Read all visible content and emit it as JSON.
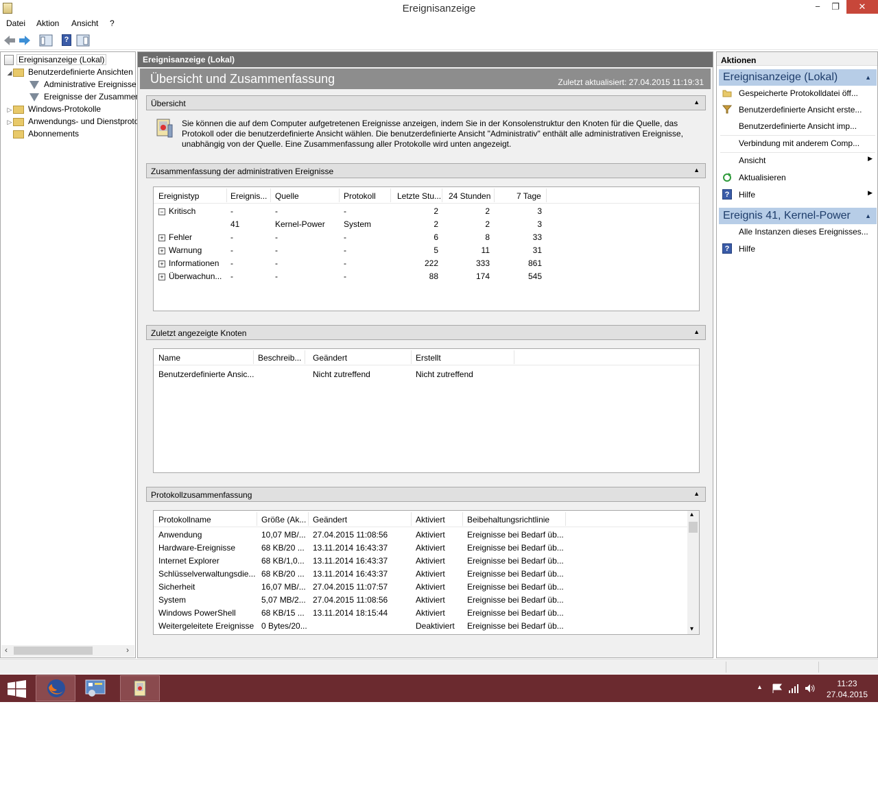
{
  "window": {
    "title": "Ereignisanzeige",
    "minimize": "−",
    "restore": "❐",
    "close": "✕"
  },
  "menu": {
    "file": "Datei",
    "action": "Aktion",
    "view": "Ansicht",
    "help": "?"
  },
  "tree": {
    "root": "Ereignisanzeige (Lokal)",
    "custom_views": "Benutzerdefinierte Ansichten",
    "admin_events": "Administrative Ereignisse",
    "summary_events": "Ereignisse der Zusammenfassung",
    "windows_logs": "Windows-Protokolle",
    "app_service_logs": "Anwendungs- und Dienstprotokolle",
    "subscriptions": "Abonnements"
  },
  "center": {
    "header": "Ereignisanzeige (Lokal)",
    "banner_title": "Übersicht und Zusammenfassung",
    "last_updated": "Zuletzt aktualisiert: 27.04.2015 11:19:31",
    "overview_section": "Übersicht",
    "overview_text": "Sie können die auf dem Computer aufgetretenen Ereignisse anzeigen, indem Sie in der Konsolenstruktur den Knoten für die Quelle, das Protokoll oder die benutzerdefinierte Ansicht wählen. Die benutzerdefinierte Ansicht \"Administrativ\" enthält alle administrativen Ereignisse, unabhängig von der Quelle. Eine Zusammenfassung aller Protokolle wird unten angezeigt.",
    "admin_summary_section": "Zusammenfassung der administrativen Ereignisse",
    "admin_table": {
      "columns": [
        "Ereignistyp",
        "Ereignis...",
        "Quelle",
        "Protokoll",
        "Letzte Stu...",
        "24 Stunden",
        "7 Tage"
      ],
      "rows": [
        {
          "type": "Kritisch",
          "expander": "−",
          "id": "-",
          "source": "-",
          "log": "-",
          "h1": "2",
          "h24": "2",
          "d7": "3"
        },
        {
          "type": "",
          "expander": "",
          "id": "41",
          "source": "Kernel-Power",
          "log": "System",
          "h1": "2",
          "h24": "2",
          "d7": "3"
        },
        {
          "type": "Fehler",
          "expander": "+",
          "id": "-",
          "source": "-",
          "log": "-",
          "h1": "6",
          "h24": "8",
          "d7": "33"
        },
        {
          "type": "Warnung",
          "expander": "+",
          "id": "-",
          "source": "-",
          "log": "-",
          "h1": "5",
          "h24": "11",
          "d7": "31"
        },
        {
          "type": "Informationen",
          "expander": "+",
          "id": "-",
          "source": "-",
          "log": "-",
          "h1": "222",
          "h24": "333",
          "d7": "861"
        },
        {
          "type": "Überwachun...",
          "expander": "+",
          "id": "-",
          "source": "-",
          "log": "-",
          "h1": "88",
          "h24": "174",
          "d7": "545"
        }
      ]
    },
    "recent_section": "Zuletzt angezeigte Knoten",
    "recent_table": {
      "columns": [
        "Name",
        "Beschreib...",
        "Geändert",
        "Erstellt"
      ],
      "rows": [
        {
          "name": "Benutzerdefinierte Ansic...",
          "desc": "",
          "changed": "Nicht zutreffend",
          "created": "Nicht zutreffend"
        }
      ]
    },
    "log_section": "Protokollzusammenfassung",
    "log_table": {
      "columns": [
        "Protokollname",
        "Größe (Ak...",
        "Geändert",
        "Aktiviert",
        "Beibehaltungsrichtlinie"
      ],
      "rows": [
        {
          "name": "Anwendung",
          "size": "10,07 MB/...",
          "changed": "27.04.2015 11:08:56",
          "enabled": "Aktiviert",
          "policy": "Ereignisse bei Bedarf üb..."
        },
        {
          "name": "Hardware-Ereignisse",
          "size": "68 KB/20 ...",
          "changed": "13.11.2014 16:43:37",
          "enabled": "Aktiviert",
          "policy": "Ereignisse bei Bedarf üb..."
        },
        {
          "name": "Internet Explorer",
          "size": "68 KB/1,0...",
          "changed": "13.11.2014 16:43:37",
          "enabled": "Aktiviert",
          "policy": "Ereignisse bei Bedarf üb..."
        },
        {
          "name": "Schlüsselverwaltungsdie...",
          "size": "68 KB/20 ...",
          "changed": "13.11.2014 16:43:37",
          "enabled": "Aktiviert",
          "policy": "Ereignisse bei Bedarf üb..."
        },
        {
          "name": "Sicherheit",
          "size": "16,07 MB/...",
          "changed": "27.04.2015 11:07:57",
          "enabled": "Aktiviert",
          "policy": "Ereignisse bei Bedarf üb..."
        },
        {
          "name": "System",
          "size": "5,07 MB/2...",
          "changed": "27.04.2015 11:08:56",
          "enabled": "Aktiviert",
          "policy": "Ereignisse bei Bedarf üb..."
        },
        {
          "name": "Windows PowerShell",
          "size": "68 KB/15 ...",
          "changed": "13.11.2014 18:15:44",
          "enabled": "Aktiviert",
          "policy": "Ereignisse bei Bedarf üb..."
        },
        {
          "name": "Weitergeleitete Ereignisse",
          "size": "0 Bytes/20...",
          "changed": "",
          "enabled": "Deaktiviert",
          "policy": "Ereignisse bei Bedarf üb..."
        }
      ]
    }
  },
  "actions": {
    "header": "Aktionen",
    "group1": "Ereignisanzeige (Lokal)",
    "items1": [
      "Gespeicherte Protokolldatei öff...",
      "Benutzerdefinierte Ansicht erste...",
      "Benutzerdefinierte Ansicht imp...",
      "Verbindung mit anderem Comp...",
      "Ansicht",
      "Aktualisieren",
      "Hilfe"
    ],
    "group2": "Ereignis 41, Kernel-Power",
    "items2": [
      "Alle Instanzen dieses Ereignisses...",
      "Hilfe"
    ]
  },
  "taskbar": {
    "time": "11:23",
    "date": "27.04.2015"
  },
  "colors": {
    "taskbar": "#6b2a2f",
    "action_group": "#b7cde7",
    "close_button": "#c7473a",
    "header_dark": "#6d6d6d"
  },
  "icons": [
    "back-arrow-icon",
    "forward-arrow-icon",
    "console-tree-icon",
    "help-icon",
    "show-pane-icon",
    "folder-icon",
    "filter-icon",
    "event-log-icon",
    "refresh-icon",
    "windows-logo-icon",
    "firefox-icon"
  ]
}
